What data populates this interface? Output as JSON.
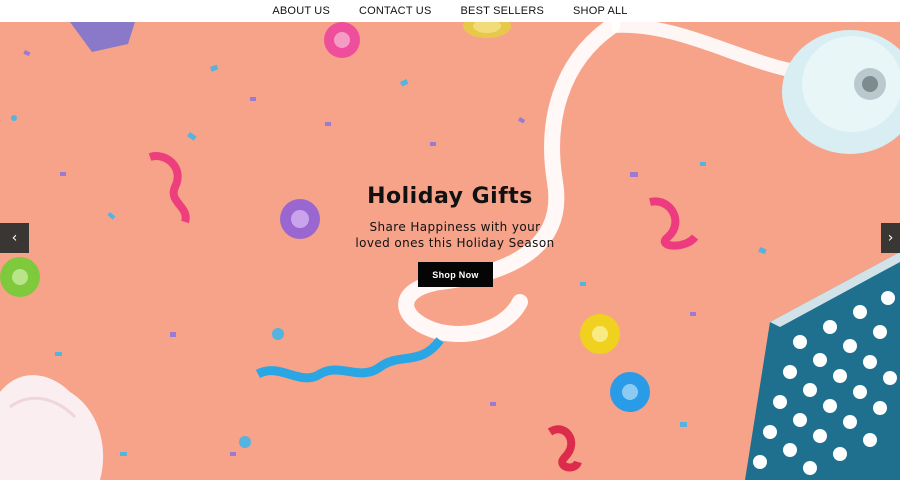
{
  "nav": {
    "items": [
      {
        "label": "ABOUT US"
      },
      {
        "label": "CONTACT US"
      },
      {
        "label": "BEST SELLERS"
      },
      {
        "label": "SHOP ALL"
      }
    ]
  },
  "hero": {
    "title": "Holiday Gifts",
    "subtitle_line1": "Share Happiness with your",
    "subtitle_line2": "loved ones this Holiday Season",
    "cta_label": "Shop Now",
    "prev_icon": "chevron-left-icon",
    "next_icon": "chevron-right-icon",
    "prev_glyph": "‹",
    "next_glyph": "›"
  },
  "colors": {
    "background": "#f6a38a",
    "nav_bg": "#ffffff",
    "cta_bg": "#050505",
    "arrow_bg": "#3a3634",
    "polka_blue": "#1f6f8f"
  }
}
